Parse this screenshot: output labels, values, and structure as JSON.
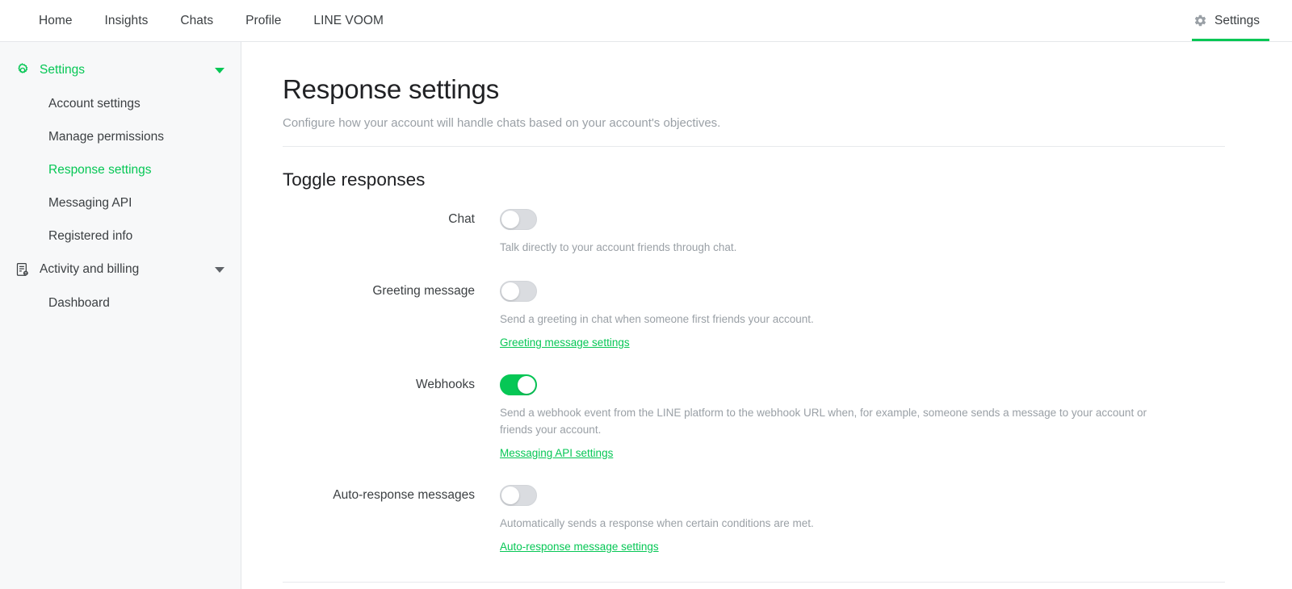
{
  "topnav": {
    "tabs": [
      {
        "label": "Home"
      },
      {
        "label": "Insights"
      },
      {
        "label": "Chats"
      },
      {
        "label": "Profile"
      },
      {
        "label": "LINE VOOM"
      }
    ],
    "settings_tab": {
      "label": "Settings",
      "icon": "gear-icon",
      "active": true
    }
  },
  "sidebar": {
    "groups": [
      {
        "label": "Settings",
        "icon": "gear-icon",
        "expanded": true,
        "active": true,
        "items": [
          {
            "label": "Account settings",
            "active": false
          },
          {
            "label": "Manage permissions",
            "active": false
          },
          {
            "label": "Response settings",
            "active": true
          },
          {
            "label": "Messaging API",
            "active": false
          },
          {
            "label": "Registered info",
            "active": false
          }
        ]
      },
      {
        "label": "Activity and billing",
        "icon": "document-receipt-icon",
        "expanded": true,
        "active": false,
        "items": [
          {
            "label": "Dashboard",
            "active": false
          }
        ]
      }
    ]
  },
  "main": {
    "title": "Response settings",
    "subtitle": "Configure how your account will handle chats based on your account's objectives.",
    "section_title": "Toggle responses",
    "rows": [
      {
        "label": "Chat",
        "enabled": false,
        "description": "Talk directly to your account friends through chat.",
        "link": null
      },
      {
        "label": "Greeting message",
        "enabled": false,
        "description": "Send a greeting in chat when someone first friends your account.",
        "link": "Greeting message settings"
      },
      {
        "label": "Webhooks",
        "enabled": true,
        "description": "Send a webhook event from the LINE platform to the webhook URL when, for example, someone sends a message to your account or friends your account.",
        "link": "Messaging API settings"
      },
      {
        "label": "Auto-response messages",
        "enabled": false,
        "description": "Automatically sends a response when certain conditions are met.",
        "link": "Auto-response message settings"
      }
    ]
  },
  "colors": {
    "brand_green": "#06c755",
    "text_primary": "#202124",
    "text_secondary": "#3c4043",
    "text_muted": "#9aa0a6",
    "sidebar_bg": "#f7f8f9",
    "toggle_off": "#dadce0"
  }
}
